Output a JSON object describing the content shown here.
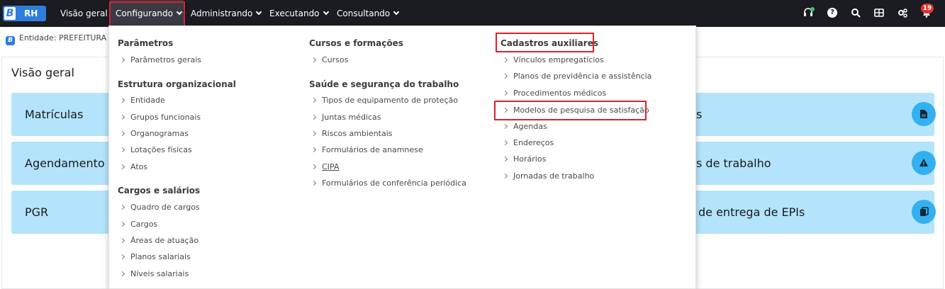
{
  "header": {
    "logo_letter": "B",
    "logo_text": "RH",
    "nav": [
      "Visão geral",
      "Configurando",
      "Administrando",
      "Executando",
      "Consultando"
    ],
    "notifications_count": "19"
  },
  "entity_label": "Entidade: PREFEITURA D",
  "page_title": "Visão geral",
  "cards": {
    "left": [
      "Matrículas",
      "Agendamento",
      "PGR"
    ],
    "right": [
      "s",
      "s de trabalho",
      "de entrega de EPIs"
    ]
  },
  "menu": {
    "col1": {
      "sections": [
        {
          "title": "Parâmetros",
          "items": [
            "Parâmetros gerais"
          ]
        },
        {
          "title": "Estrutura organizacional",
          "items": [
            "Entidade",
            "Grupos funcionais",
            "Organogramas",
            "Lotações físicas",
            "Atos"
          ]
        },
        {
          "title": "Cargos e salários",
          "items": [
            "Quadro de cargos",
            "Cargos",
            "Áreas de atuação",
            "Planos salariais",
            "Níveis salariais"
          ]
        }
      ]
    },
    "col2": {
      "sections": [
        {
          "title": "Cursos e formações",
          "items": [
            "Cursos"
          ]
        },
        {
          "title": "Saúde e segurança do trabalho",
          "items": [
            "Tipos de equipamento de proteção",
            "Juntas médicas",
            "Riscos ambientais",
            "Formulários de anamnese",
            "CIPA",
            "Formulários de conferência periódica"
          ]
        }
      ]
    },
    "col3": {
      "sections": [
        {
          "title": "Cadastros auxiliares",
          "items": [
            "Vínculos empregatícios",
            "Planos de previdência e assistência",
            "Procedimentos médicos",
            "Modelos de pesquisa de satisfação",
            "Agendas",
            "Endereços",
            "Horários",
            "Jornadas de trabalho"
          ]
        }
      ]
    }
  },
  "colors": {
    "topbar": "#1b1b22",
    "card_bg": "#b4e4fb",
    "card_button": "#34b0ef",
    "highlight": "#d9232d",
    "brand": "#2e7ddb"
  }
}
